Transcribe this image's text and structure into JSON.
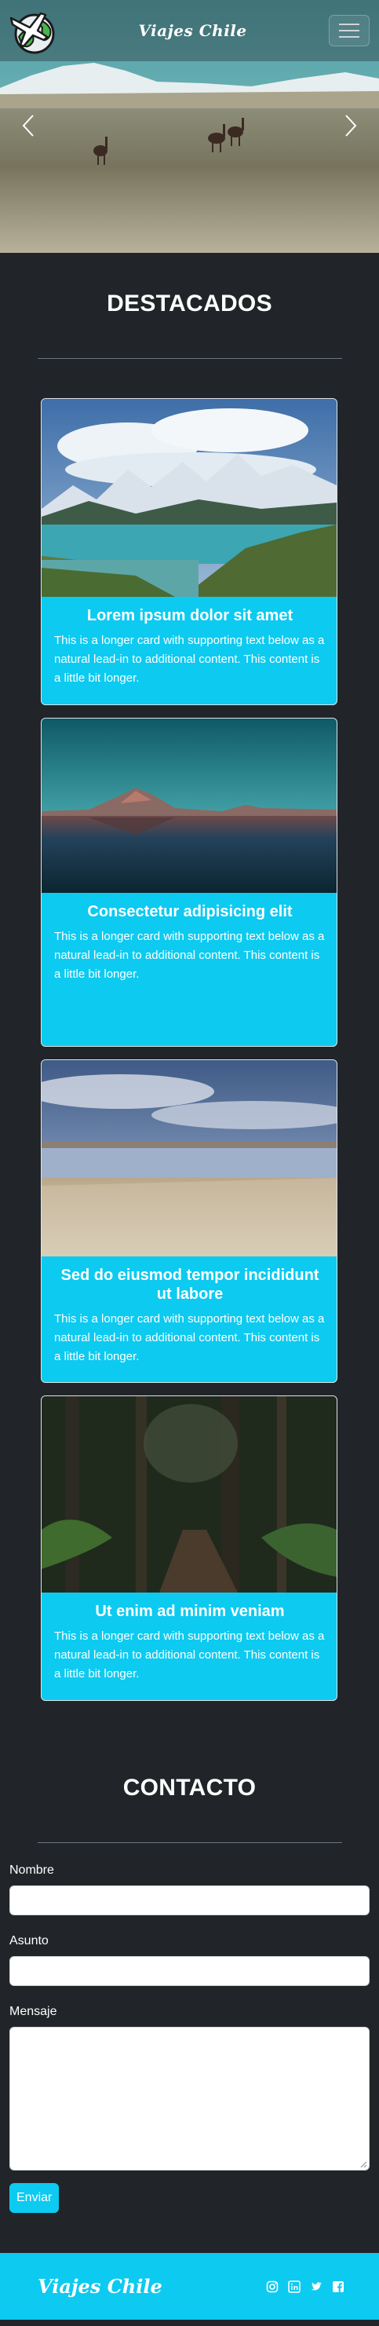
{
  "nav": {
    "brand": "Viajes Chile",
    "logo_icon": "plane-globe-logo-icon",
    "menu_icon": "hamburger-menu-icon"
  },
  "hero": {
    "prev_icon": "chevron-left-icon",
    "next_icon": "chevron-right-icon"
  },
  "featured": {
    "title": "DESTACADOS",
    "cards": [
      {
        "title": "Lorem ipsum dolor sit amet",
        "text": "This is a longer card with supporting text below as a natural lead-in to additional content. This content is a little bit longer."
      },
      {
        "title": "Consectetur adipisicing elit",
        "text": "This is a longer card with supporting text below as a natural lead-in to additional content. This content is a little bit longer."
      },
      {
        "title": "Sed do eiusmod tempor incididunt ut labore",
        "text": "This is a longer card with supporting text below as a natural lead-in to additional content. This content is a little bit longer."
      },
      {
        "title": "Ut enim ad minim veniam",
        "text": "This is a longer card with supporting text below as a natural lead-in to additional content. This content is a little bit longer."
      }
    ]
  },
  "contact": {
    "title": "CONTACTO",
    "name_label": "Nombre",
    "subject_label": "Asunto",
    "message_label": "Mensaje",
    "submit_label": "Enviar"
  },
  "footer": {
    "brand": "Viajes Chile",
    "social_icons": [
      "instagram-icon",
      "linkedin-icon",
      "twitter-icon",
      "facebook-icon"
    ]
  },
  "colors": {
    "background": "#212529",
    "accent": "#0dcaf0",
    "divider": "#6c757d"
  }
}
